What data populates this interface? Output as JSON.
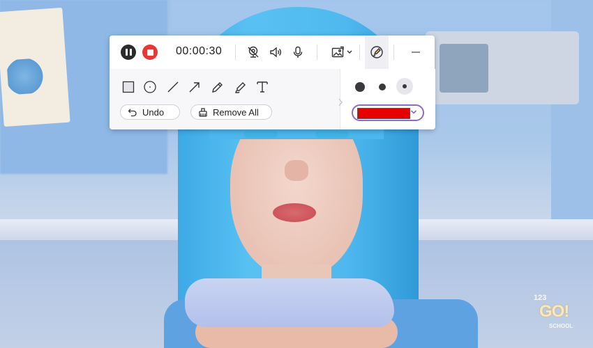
{
  "toolbar": {
    "timer": "00:00:30",
    "undo_label": "Undo",
    "remove_all_label": "Remove All"
  },
  "icons": {
    "pause": "pause-icon",
    "stop": "stop-icon",
    "webcam_off": "webcam-off-icon",
    "speaker": "speaker-icon",
    "microphone": "microphone-icon",
    "screenshot": "screenshot-icon",
    "draw": "draw-pen-icon",
    "minimize": "minimize-icon",
    "rectangle": "rectangle-tool-icon",
    "ellipse": "ellipse-tool-icon",
    "line": "line-tool-icon",
    "arrow": "arrow-tool-icon",
    "pencil": "pencil-tool-icon",
    "highlighter": "highlighter-tool-icon",
    "text": "text-tool-icon"
  },
  "brush": {
    "sizes": [
      "large",
      "medium",
      "small"
    ],
    "selected_size": "small",
    "color": "#e60000"
  },
  "watermark": {
    "number": "123",
    "brand": "GO!",
    "sub": "SCHOOL"
  }
}
